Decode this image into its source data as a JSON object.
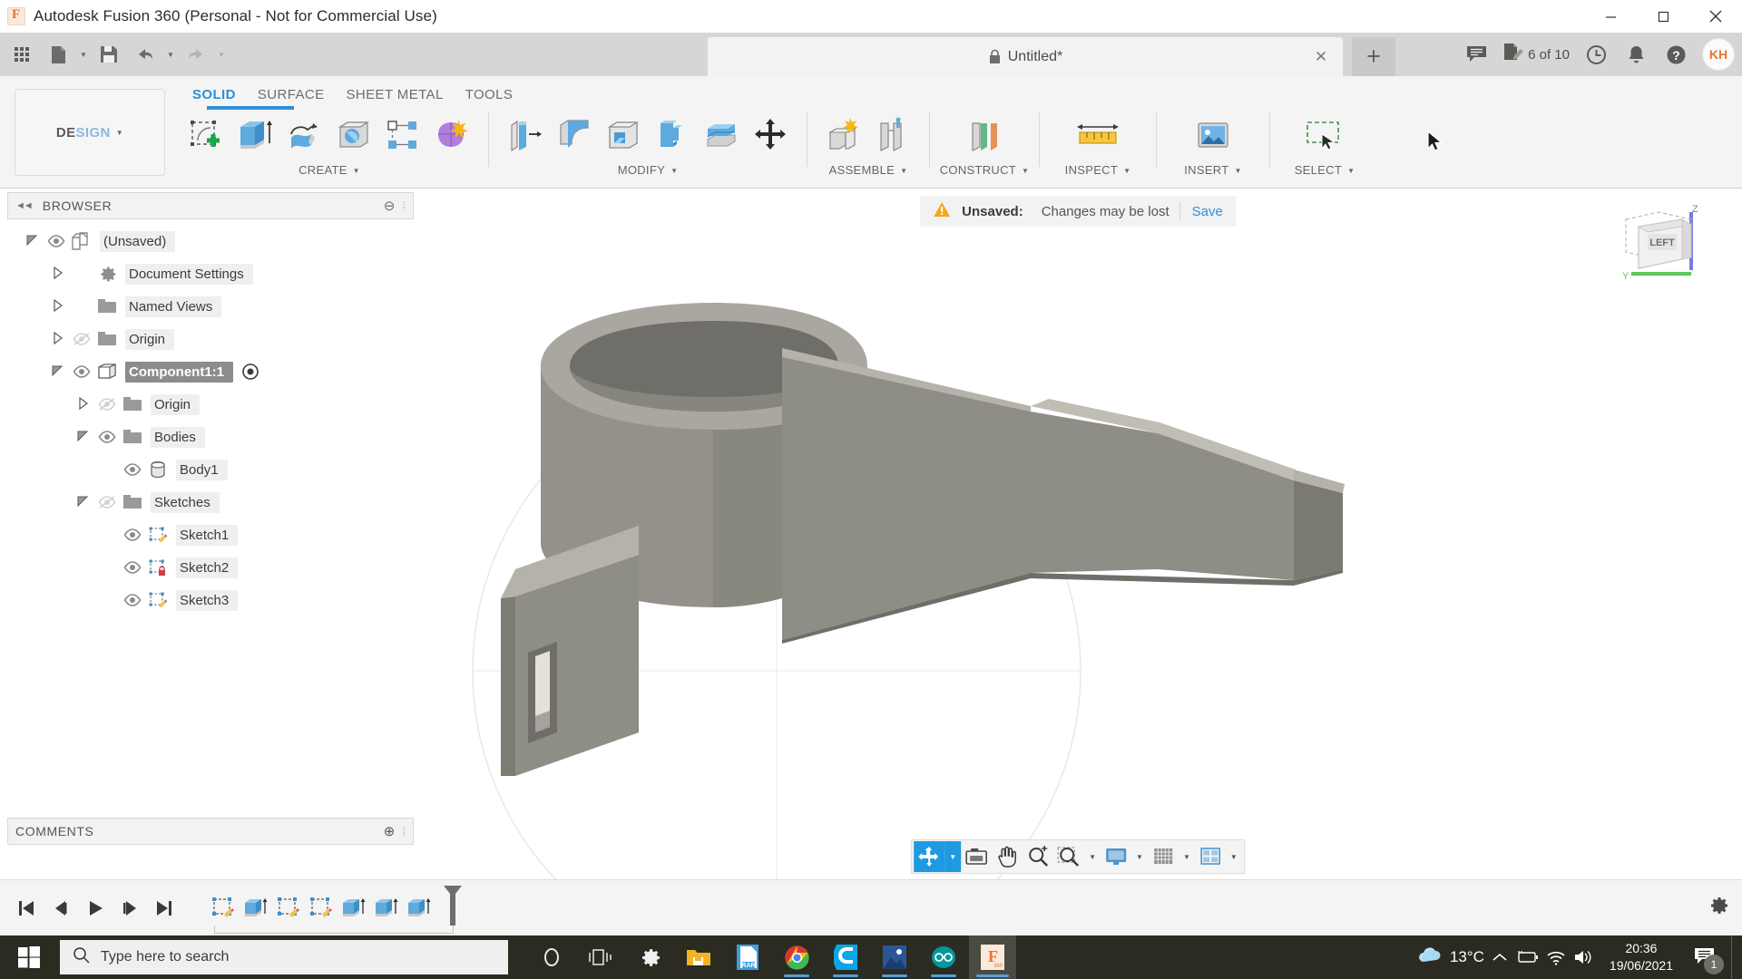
{
  "window": {
    "title": "Autodesk Fusion 360 (Personal - Not for Commercial Use)",
    "logo_letter": "F",
    "minimize": "—",
    "maximize": "❐",
    "close": "✕"
  },
  "quick_access": {
    "items": [
      {
        "name": "app-grid-icon",
        "label": "Apps"
      },
      {
        "name": "new-file-icon",
        "label": "New"
      },
      {
        "name": "save-icon",
        "label": "Save"
      },
      {
        "name": "undo-icon",
        "label": "Undo"
      },
      {
        "name": "redo-icon",
        "label": "Redo"
      }
    ]
  },
  "document_tab": {
    "name": "Untitled*",
    "lock_icon": "lock-icon",
    "close_label": "✕",
    "add_label": "+"
  },
  "top_right": {
    "comments_icon": "comment-icon",
    "jobs_icon": "jobs-icon",
    "jobs_label": "6 of 10",
    "history_icon": "clock-icon",
    "notifications_icon": "bell-icon",
    "help_icon": "help-icon",
    "avatar_initials": "KH"
  },
  "ribbon": {
    "workspace": "DESIGN",
    "workspace_prefix": "DE",
    "workspace_suffix": "SIGN",
    "tabs": [
      {
        "label": "SOLID",
        "active": true
      },
      {
        "label": "SURFACE",
        "active": false
      },
      {
        "label": "SHEET METAL",
        "active": false
      },
      {
        "label": "TOOLS",
        "active": false
      }
    ],
    "groups": [
      {
        "label": "CREATE",
        "has_caret": true,
        "icons": [
          "create-sketch-icon",
          "extrude-icon",
          "revolve-icon",
          "sweep-icon",
          "pattern-icon",
          "form-icon"
        ]
      },
      {
        "label": "MODIFY",
        "has_caret": true,
        "icons": [
          "press-pull-icon",
          "fillet-icon",
          "shell-icon",
          "combine-icon",
          "offset-face-icon",
          "move-copy-icon"
        ]
      },
      {
        "label": "ASSEMBLE",
        "has_caret": true,
        "icons": [
          "new-component-icon",
          "joint-icon"
        ]
      },
      {
        "label": "CONSTRUCT",
        "has_caret": true,
        "icons": [
          "offset-plane-icon"
        ]
      },
      {
        "label": "INSPECT",
        "has_caret": true,
        "icons": [
          "measure-icon"
        ]
      },
      {
        "label": "INSERT",
        "has_caret": true,
        "icons": [
          "insert-image-icon"
        ]
      },
      {
        "label": "SELECT",
        "has_caret": true,
        "icons": [
          "select-window-icon"
        ]
      }
    ]
  },
  "browser": {
    "header": {
      "collapse_icon": "collapse-arrows-icon",
      "title": "BROWSER",
      "minimize_icon": "minimize-icon",
      "grip_icon": "grip-icon"
    },
    "tree": [
      {
        "label": "(Unsaved)",
        "depth": 0,
        "chev": "expanded",
        "eye": "visible",
        "icon": "document-icon",
        "selected": false,
        "target": false
      },
      {
        "label": "Document Settings",
        "depth": 1,
        "chev": "collapsed",
        "eye": "none",
        "icon": "gear-icon",
        "selected": false,
        "target": false
      },
      {
        "label": "Named Views",
        "depth": 1,
        "chev": "collapsed",
        "eye": "none",
        "icon": "folder-icon",
        "selected": false,
        "target": false
      },
      {
        "label": "Origin",
        "depth": 1,
        "chev": "collapsed",
        "eye": "hidden",
        "icon": "folder-icon",
        "selected": false,
        "target": false
      },
      {
        "label": "Component1:1",
        "depth": 1,
        "chev": "expanded",
        "eye": "visible",
        "icon": "component-icon",
        "selected": true,
        "target": true
      },
      {
        "label": "Origin",
        "depth": 2,
        "chev": "collapsed",
        "eye": "hidden",
        "icon": "folder-icon",
        "selected": false,
        "target": false
      },
      {
        "label": "Bodies",
        "depth": 2,
        "chev": "expanded",
        "eye": "visible",
        "icon": "folder-icon",
        "selected": false,
        "target": false
      },
      {
        "label": "Body1",
        "depth": 3,
        "chev": "none",
        "eye": "visible",
        "icon": "body-icon",
        "selected": false,
        "target": false
      },
      {
        "label": "Sketches",
        "depth": 2,
        "chev": "expanded",
        "eye": "hidden",
        "icon": "folder-icon",
        "selected": false,
        "target": false
      },
      {
        "label": "Sketch1",
        "depth": 3,
        "chev": "none",
        "eye": "visible",
        "icon": "sketch-icon",
        "selected": false,
        "target": false
      },
      {
        "label": "Sketch2",
        "depth": 3,
        "chev": "none",
        "eye": "visible",
        "icon": "sketch-locked-icon",
        "selected": false,
        "target": false
      },
      {
        "label": "Sketch3",
        "depth": 3,
        "chev": "none",
        "eye": "visible",
        "icon": "sketch-icon",
        "selected": false,
        "target": false
      }
    ]
  },
  "comments": {
    "title": "COMMENTS",
    "add_icon": "add-comment-icon",
    "grip_icon": "grip-icon"
  },
  "canvas": {
    "unsaved_banner": {
      "warning_icon": "warning-icon",
      "label": "Unsaved:",
      "message": "Changes may be lost",
      "action": "Save"
    },
    "viewcube": {
      "face_label": "LEFT",
      "axis_z": "Z",
      "axis_y": "Y"
    },
    "model": {
      "name": "body1-clamp-model",
      "material_light": "#c9c6bd",
      "material_mid": "#8e8d86",
      "material_dark": "#6f6e68"
    },
    "nav_toolbar": [
      {
        "name": "orbit-button",
        "icon": "orbit-icon",
        "caret": true,
        "selected": true
      },
      {
        "name": "look-at-button",
        "icon": "look-at-icon",
        "caret": false,
        "selected": false
      },
      {
        "name": "pan-button",
        "icon": "pan-hand-icon",
        "caret": false,
        "selected": false
      },
      {
        "name": "zoom-button",
        "icon": "zoom-icon",
        "caret": false,
        "selected": false
      },
      {
        "name": "fit-button",
        "icon": "zoom-window-icon",
        "caret": true,
        "selected": false
      },
      {
        "name": "display-settings-button",
        "icon": "display-icon",
        "caret": true,
        "selected": false
      },
      {
        "name": "grid-snaps-button",
        "icon": "grid-icon",
        "caret": true,
        "selected": false
      },
      {
        "name": "viewports-button",
        "icon": "viewports-icon",
        "caret": true,
        "selected": false
      }
    ]
  },
  "timeline": {
    "playback": [
      {
        "name": "go-to-beginning-button",
        "icon": "skip-start-icon"
      },
      {
        "name": "step-back-button",
        "icon": "step-back-icon"
      },
      {
        "name": "play-button",
        "icon": "play-icon"
      },
      {
        "name": "step-forward-button",
        "icon": "step-forward-icon"
      },
      {
        "name": "go-to-end-button",
        "icon": "skip-end-icon"
      }
    ],
    "features": [
      {
        "name": "timeline-feature-sketch1",
        "icon": "sketch-icon"
      },
      {
        "name": "timeline-feature-extrude1",
        "icon": "extrude-icon"
      },
      {
        "name": "timeline-feature-sketch2",
        "icon": "sketch-icon"
      },
      {
        "name": "timeline-feature-sketch3",
        "icon": "sketch-icon"
      },
      {
        "name": "timeline-feature-extrude2",
        "icon": "extrude-icon"
      },
      {
        "name": "timeline-feature-extrude3",
        "icon": "extrude-icon"
      },
      {
        "name": "timeline-feature-extrude4",
        "icon": "extrude-icon"
      }
    ],
    "marker_icon": "timeline-marker-icon",
    "settings_icon": "gear-icon"
  },
  "taskbar": {
    "start_icon": "windows-start-icon",
    "search_placeholder": "Type here to search",
    "search_icon": "search-icon",
    "pinned": [
      {
        "name": "cortana-icon",
        "label": "Cortana",
        "state": "idle"
      },
      {
        "name": "task-view-icon",
        "label": "Task View",
        "state": "idle"
      },
      {
        "name": "settings-icon",
        "label": "Settings",
        "state": "idle"
      },
      {
        "name": "file-explorer-icon",
        "label": "File Explorer",
        "state": "idle"
      },
      {
        "name": "winrar-icon",
        "label": "RAR",
        "state": "idle"
      },
      {
        "name": "chrome-icon",
        "label": "Google Chrome",
        "state": "running"
      },
      {
        "name": "cura-icon",
        "label": "Cura",
        "state": "running"
      },
      {
        "name": "photos-icon",
        "label": "Photos",
        "state": "running"
      },
      {
        "name": "arduino-icon",
        "label": "Arduino",
        "state": "running"
      },
      {
        "name": "fusion360-icon",
        "label": "Fusion 360",
        "state": "active"
      }
    ],
    "tray": {
      "weather_icon": "cloud-icon",
      "temperature": "13°C",
      "chevron_icon": "chevron-up-icon",
      "battery_icon": "battery-charging-icon",
      "wifi_icon": "wifi-icon",
      "volume_icon": "volume-icon",
      "time": "20:36",
      "date": "19/06/2021",
      "notification_icon": "notification-icon",
      "notification_count": "1"
    }
  },
  "colors": {
    "accent_blue": "#2f8fd8",
    "orange": "#e8762c",
    "warning": "#f4a81d",
    "selection_gray": "#8c8c8c",
    "taskbar": "#2b2b22"
  }
}
